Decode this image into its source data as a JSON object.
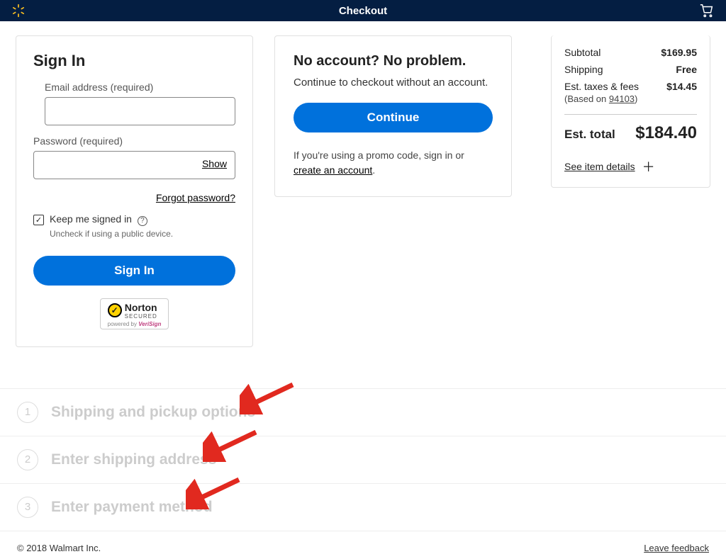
{
  "header": {
    "title": "Checkout"
  },
  "signin": {
    "title": "Sign In",
    "emailLabel": "Email address (required)",
    "passwordLabel": "Password (required)",
    "show": "Show",
    "forgot": "Forgot password?",
    "keep": "Keep me signed in",
    "keepSub": "Uncheck if using a public device.",
    "button": "Sign In",
    "nortonName": "Norton",
    "nortonSecured": "SECURED",
    "nortonPowered": "powered by ",
    "nortonVerisign": "VeriSign"
  },
  "guest": {
    "title": "No account? No problem.",
    "sub": "Continue to checkout without an account.",
    "button": "Continue",
    "promo1": "If you're using a promo code, sign in or ",
    "promoLink": "create an account",
    "promoEnd": "."
  },
  "summary": {
    "subtotalLabel": "Subtotal",
    "subtotalVal": "$169.95",
    "shippingLabel": "Shipping",
    "shippingVal": "Free",
    "taxLabel": "Est. taxes & fees",
    "taxVal": "$14.45",
    "basedOn": "(Based on ",
    "zip": "94103",
    "basedEnd": ")",
    "estLabel": "Est. total",
    "estVal": "$184.40",
    "details": "See item details"
  },
  "steps": [
    {
      "num": "1",
      "label": "Shipping and pickup options"
    },
    {
      "num": "2",
      "label": "Enter shipping address"
    },
    {
      "num": "3",
      "label": "Enter payment method"
    }
  ],
  "footer": {
    "copyright": "© 2018 Walmart Inc.",
    "feedback": "Leave feedback"
  }
}
